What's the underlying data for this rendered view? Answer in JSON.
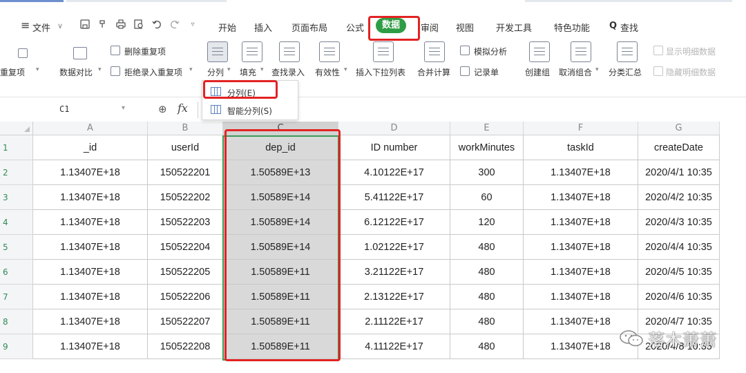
{
  "menu": {
    "hamburger_icon": "≡",
    "file_label": "文件",
    "file_chevron": "∨",
    "tabs": [
      "开始",
      "插入",
      "页面布局",
      "公式",
      "数据",
      "审阅",
      "视图",
      "开发工具",
      "特色功能"
    ],
    "search_icon": "Q",
    "search_label": "查找",
    "active_tab": "数据",
    "active_color": "#2f9d45"
  },
  "ribbon": {
    "left_cut_label": "重复项",
    "data_compare": "数据对比",
    "delete_duplicates": "删除重复项",
    "reject_duplicates": "拒绝录入重复项",
    "split": "分列",
    "fill": "填充",
    "find_entry": "查找录入",
    "validity": "有效性",
    "insert_dropdown": "插入下拉列表",
    "consolidate": "合并计算",
    "simulate": "模拟分析",
    "record_form": "记录单",
    "create_group": "创建组",
    "ungroup": "取消组合",
    "subtotal": "分类汇总",
    "show_detail": "显示明细数据",
    "hide_detail": "隐藏明细数据"
  },
  "split_menu": {
    "items": [
      "分列(E)",
      "智能分列(S)"
    ]
  },
  "formula_bar": {
    "name_box": "C1",
    "fx_label": "fx",
    "zoom_icon": "⊕",
    "formula": ""
  },
  "sheet": {
    "columns": [
      "A",
      "B",
      "C",
      "D",
      "E",
      "F",
      "G"
    ],
    "selected_column": "C",
    "rows": [
      {
        "num": "1",
        "cells": [
          "_id",
          "userId",
          "dep_id",
          "ID number",
          "workMinutes",
          "taskId",
          "createDate"
        ]
      },
      {
        "num": "2",
        "cells": [
          "1.13407E+18",
          "150522201",
          "1.50589E+13",
          "4.10122E+17",
          "300",
          "1.13407E+18",
          "2020/4/1 10:35"
        ]
      },
      {
        "num": "3",
        "cells": [
          "1.13407E+18",
          "150522202",
          "1.50589E+14",
          "5.41122E+17",
          "60",
          "1.13407E+18",
          "2020/4/2 10:35"
        ]
      },
      {
        "num": "4",
        "cells": [
          "1.13407E+18",
          "150522203",
          "1.50589E+14",
          "6.12122E+17",
          "120",
          "1.13407E+18",
          "2020/4/3 10:35"
        ]
      },
      {
        "num": "5",
        "cells": [
          "1.13407E+18",
          "150522204",
          "1.50589E+14",
          "1.02122E+17",
          "480",
          "1.13407E+18",
          "2020/4/4 10:35"
        ]
      },
      {
        "num": "6",
        "cells": [
          "1.13407E+18",
          "150522205",
          "1.50589E+11",
          "3.21122E+17",
          "480",
          "1.13407E+18",
          "2020/4/5 10:35"
        ]
      },
      {
        "num": "7",
        "cells": [
          "1.13407E+18",
          "150522206",
          "1.50589E+11",
          "2.13122E+17",
          "480",
          "1.13407E+18",
          "2020/4/6 10:35"
        ]
      },
      {
        "num": "8",
        "cells": [
          "1.13407E+18",
          "150522207",
          "1.50589E+11",
          "2.11122E+17",
          "480",
          "1.13407E+18",
          "2020/4/7 10:35"
        ]
      },
      {
        "num": "9",
        "cells": [
          "1.13407E+18",
          "150522208",
          "1.50589E+11",
          "4.11122E+17",
          "480",
          "1.13407E+18",
          "2020/4/8 10:35"
        ]
      }
    ]
  },
  "watermark": {
    "text": "落木萧萧"
  },
  "colors": {
    "highlight_box": "#e32222",
    "selection_outline": "#3a9b55",
    "selected_cells": "#d9d9d9",
    "row_number": "#2e8b57"
  }
}
